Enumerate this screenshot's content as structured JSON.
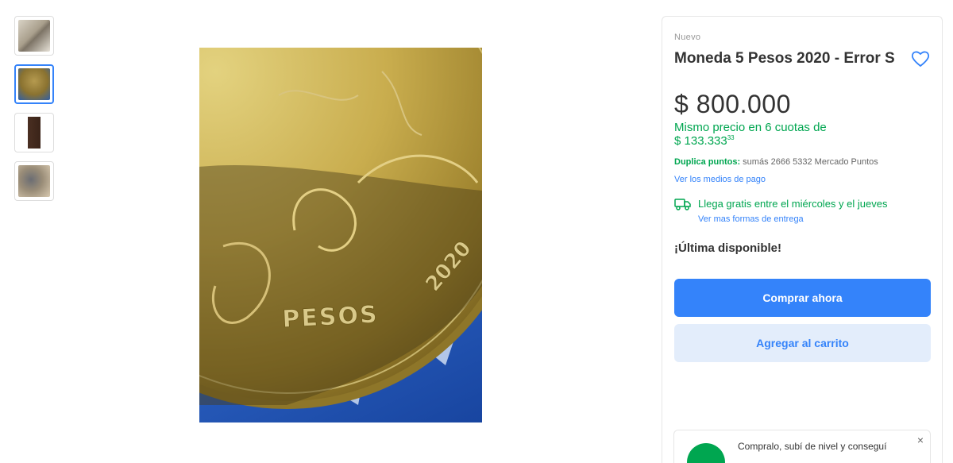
{
  "gallery": {
    "thumbnails": [
      "thumbnail-1",
      "thumbnail-2",
      "thumbnail-3",
      "thumbnail-4"
    ],
    "active_index": 1,
    "coin_text": {
      "denomination": "PESOS",
      "year": "2020"
    }
  },
  "product": {
    "condition": "Nuevo",
    "title": "Moneda 5 Pesos 2020 - Error S",
    "price": "$ 800.000",
    "installments_line1": "Mismo precio en 6 cuotas de",
    "installments_amount": "$ 133.333",
    "installments_cents": "33",
    "points_label": "Duplica puntos:",
    "points_text": " sumás 2666 5332 Mercado Puntos",
    "payment_link": "Ver los medios de pago",
    "shipping_text": "Llega gratis entre el miércoles y el jueves",
    "shipping_link": "Ver mas formas de entrega",
    "stock": "¡Última disponible!",
    "buy_now": "Comprar ahora",
    "add_to_cart": "Agregar al carrito",
    "promo_text": "Compralo, subí de nivel y conseguí",
    "promo_close": "×"
  },
  "colors": {
    "accent": "#3483fa",
    "green": "#00a650"
  },
  "icons": {
    "favorite": "heart-icon",
    "shipping": "truck-icon",
    "close": "close-icon"
  }
}
